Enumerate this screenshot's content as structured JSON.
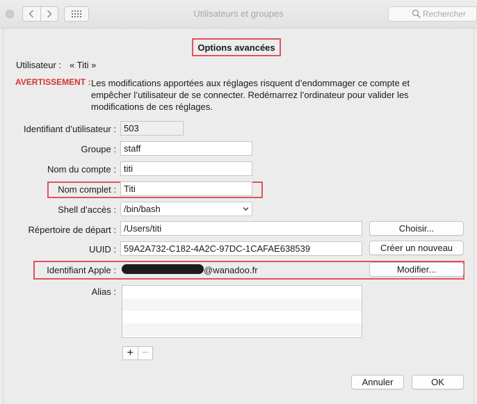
{
  "window": {
    "title": "Utilisateurs et groupes"
  },
  "toolbar": {
    "search_placeholder": "Rechercher"
  },
  "sheet": {
    "title": "Options avancées",
    "user_label": "Utilisateur :",
    "user_value": "« Titi »",
    "warning_label": "AVERTISSEMENT :",
    "warning_text_1": "Les modifications apportées aux réglages risquent d’endommager ce compte et",
    "warning_text_2": "empêcher l’utilisateur de se connecter. Redémarrez l’ordinateur pour valider les",
    "warning_text_3": "modifications de ces réglages.",
    "fields": {
      "uid_label": "Identifiant d’utilisateur :",
      "uid_value": "503",
      "group_label": "Groupe :",
      "group_value": "staff",
      "account_label": "Nom du compte :",
      "account_value": "titi",
      "fullname_label": "Nom complet :",
      "fullname_value": "Titi",
      "shell_label": "Shell d’accès :",
      "shell_value": "/bin/bash",
      "home_label": "Répertoire de départ :",
      "home_value": "/Users/titi",
      "uuid_label": "UUID :",
      "uuid_value": "59A2A732-C182-4A2C-97DC-1CAFAE638539",
      "appleid_label": "Identifiant Apple :",
      "appleid_value_suffix": "@wanadoo.fr",
      "alias_label": "Alias :"
    },
    "buttons": {
      "choose": "Choisir...",
      "new_uuid": "Créer un nouveau",
      "modify": "Modifier...",
      "add": "+",
      "remove": "−",
      "cancel": "Annuler",
      "ok": "OK"
    }
  }
}
